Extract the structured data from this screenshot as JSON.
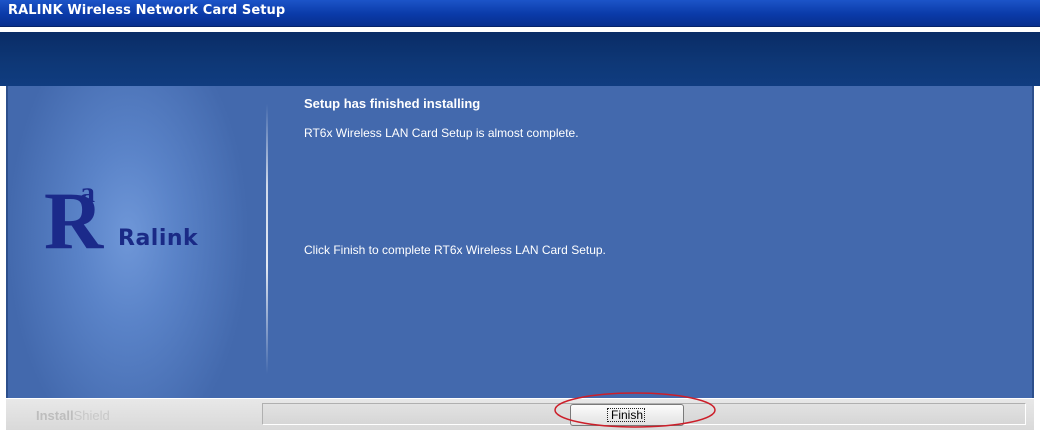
{
  "window": {
    "title": "RALINK Wireless Network Card Setup"
  },
  "logo": {
    "text": "Ralink"
  },
  "content": {
    "heading": "Setup has finished installing",
    "line1": "RT6x Wireless LAN Card Setup is almost complete.",
    "line2": "Click Finish to complete RT6x Wireless LAN Card Setup."
  },
  "footer": {
    "brand_bold": "Install",
    "brand_light": "Shield",
    "finish_label": "Finish"
  },
  "colors": {
    "titlebar": "#0a3aa8",
    "header_band": "#0e3877",
    "panel": "#4369ad",
    "logo": "#1b2a8a",
    "annotation": "#cc1f2a"
  },
  "icons": [
    "ralink-logo-icon"
  ]
}
